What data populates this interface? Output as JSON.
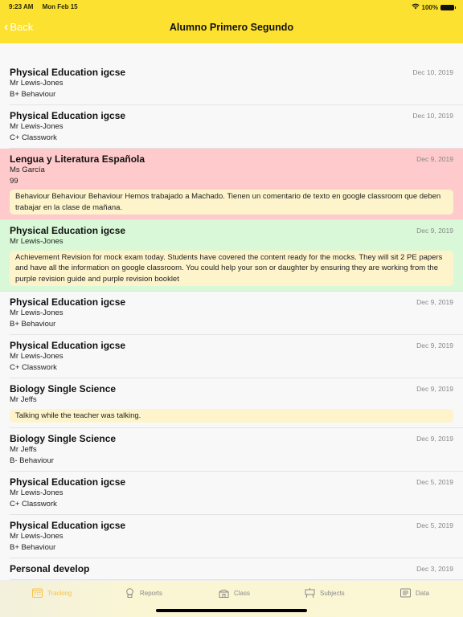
{
  "status": {
    "time": "9:23 AM",
    "date": "Mon Feb 15",
    "battery": "100%"
  },
  "nav": {
    "back_label": "Back",
    "title": "Alumno Primero Segundo"
  },
  "entries": [
    {
      "subject": "Physical Education igcse",
      "teacher": "Mr Lewis-Jones",
      "grade": "B+ Behaviour",
      "date": "Dec 10, 2019",
      "note": null,
      "tone": "plain"
    },
    {
      "subject": "Physical Education igcse",
      "teacher": "Mr Lewis-Jones",
      "grade": "C+ Classwork",
      "date": "Dec 10, 2019",
      "note": null,
      "tone": "plain"
    },
    {
      "subject": "Lengua y Literatura Española",
      "teacher": "Ms García",
      "grade": "99",
      "date": "Dec 9, 2019",
      "note": "Behaviour Behaviour Behaviour Hemos trabajado a Machado. Tienen un comentario de texto en google classroom que deben trabajar en la clase de mañana.",
      "tone": "red"
    },
    {
      "subject": "Physical Education igcse",
      "teacher": "Mr Lewis-Jones",
      "grade": null,
      "date": "Dec 9, 2019",
      "note": "Achievement Revision for mock exam today. Students have covered the content ready for the mocks. They will sit 2 PE papers and have all the information on google classroom. You could help your son or daughter by ensuring they are working from the purple revision guide and purple revision booklet",
      "tone": "green"
    },
    {
      "subject": "Physical Education igcse",
      "teacher": "Mr Lewis-Jones",
      "grade": "B+ Behaviour",
      "date": "Dec 9, 2019",
      "note": null,
      "tone": "plain"
    },
    {
      "subject": "Physical Education igcse",
      "teacher": "Mr Lewis-Jones",
      "grade": "C+ Classwork",
      "date": "Dec 9, 2019",
      "note": null,
      "tone": "plain"
    },
    {
      "subject": "Biology Single Science",
      "teacher": "Mr Jeffs",
      "grade": null,
      "date": "Dec 9, 2019",
      "note": "Talking while the teacher was talking.",
      "tone": "plain"
    },
    {
      "subject": "Biology Single Science",
      "teacher": "Mr Jeffs",
      "grade": "B- Behaviour",
      "date": "Dec 9, 2019",
      "note": null,
      "tone": "plain"
    },
    {
      "subject": "Physical Education igcse",
      "teacher": "Mr Lewis-Jones",
      "grade": "C+ Classwork",
      "date": "Dec 5, 2019",
      "note": null,
      "tone": "plain"
    },
    {
      "subject": "Physical Education igcse",
      "teacher": "Mr Lewis-Jones",
      "grade": "B+ Behaviour",
      "date": "Dec 5, 2019",
      "note": null,
      "tone": "plain"
    },
    {
      "subject": "Personal develop",
      "teacher": null,
      "grade": null,
      "date": "Dec 3, 2019",
      "note": null,
      "tone": "plain"
    }
  ],
  "tabs": [
    {
      "label": "Tracking",
      "icon": "calendar-icon",
      "active": true
    },
    {
      "label": "Reports",
      "icon": "award-icon",
      "active": false
    },
    {
      "label": "Class",
      "icon": "school-icon",
      "active": false
    },
    {
      "label": "Subjects",
      "icon": "easel-icon",
      "active": false
    },
    {
      "label": "Data",
      "icon": "document-icon",
      "active": false
    }
  ],
  "colors": {
    "header": "#fde130",
    "active_tab": "#f7c24a",
    "red_row": "#fecacb",
    "green_row": "#d9f8d8",
    "note_bg": "#fdf4cc"
  }
}
